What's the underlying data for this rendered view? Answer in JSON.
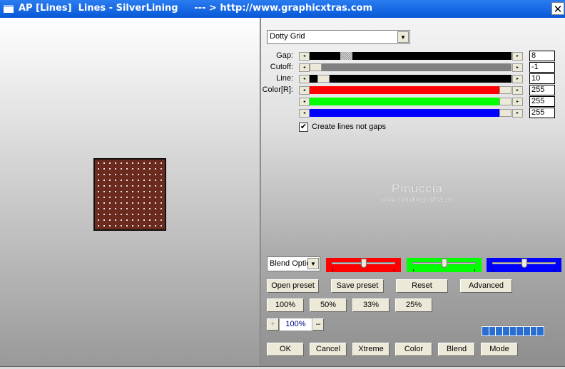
{
  "window": {
    "title": "AP [Lines]  Lines - SilverLining     --- > http://www.graphicxtras.com",
    "close": "✕"
  },
  "preset_select": {
    "value": "Dotty Grid"
  },
  "sliders": [
    {
      "label": "Gap:",
      "value": "8",
      "fraction": 0.16,
      "track_color": "#000000"
    },
    {
      "label": "Cutoff:",
      "value": "-1",
      "fraction": 0.0,
      "track_color": "#808080"
    },
    {
      "label": "Line:",
      "value": "10",
      "fraction": 0.04,
      "track_color": "#000000"
    },
    {
      "label": "Color[R]:",
      "value": "255",
      "fraction": 1.0,
      "track_color": "#ff0000"
    },
    {
      "label": "",
      "value": "255",
      "fraction": 1.0,
      "track_color": "#00ff00"
    },
    {
      "label": "",
      "value": "255",
      "fraction": 1.0,
      "track_color": "#0000ff"
    }
  ],
  "checkbox": {
    "label": "Create lines not gaps",
    "checked": true,
    "mark": "✔"
  },
  "watermark": {
    "name": "Pinuccia",
    "url": "www.maidiregrafica.eu"
  },
  "blend_select": {
    "value": "Blend Optio"
  },
  "color_sliders": [
    {
      "color": "#ff0000",
      "fraction": 0.5
    },
    {
      "color": "#00ff00",
      "fraction": 0.5
    },
    {
      "color": "#0000ff",
      "fraction": 0.5
    }
  ],
  "buttons": {
    "open_preset": "Open preset",
    "save_preset": "Save preset",
    "reset": "Reset",
    "advanced": "Advanced",
    "z100": "100%",
    "z50": "50%",
    "z33": "33%",
    "z25": "25%",
    "ok": "OK",
    "cancel": "Cancel",
    "xtreme": "Xtreme",
    "color": "Color",
    "blend": "Blend",
    "mode": "Mode"
  },
  "zoom": {
    "plus": "+",
    "value": "100%",
    "minus": "–"
  },
  "progress": {
    "segments": 9,
    "filled": 9,
    "color": "#2a6fd0"
  }
}
